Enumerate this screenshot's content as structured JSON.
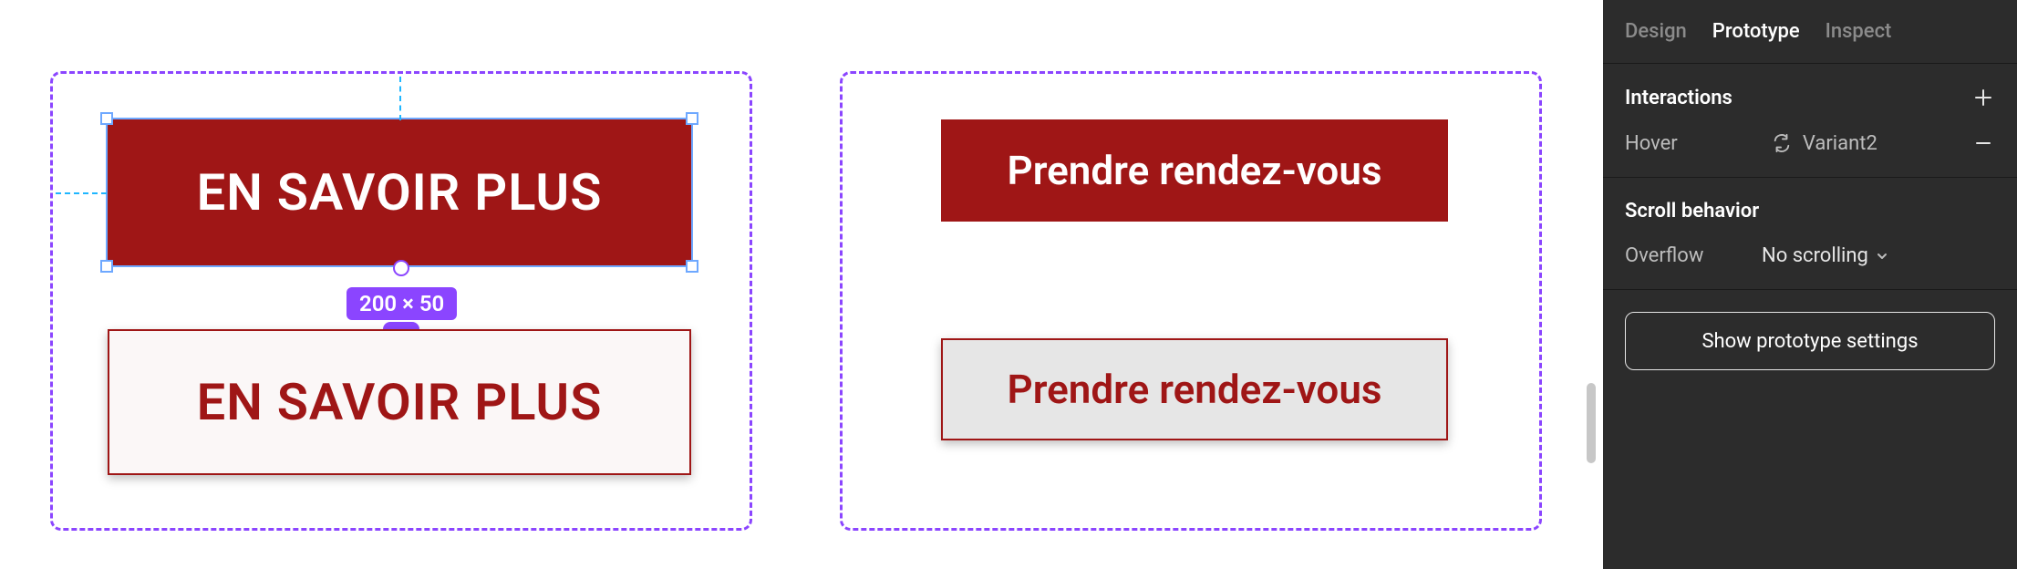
{
  "canvas": {
    "frameA": {
      "btn1": "EN SAVOIR PLUS",
      "btn2": "EN SAVOIR PLUS",
      "dimensions": "200 × 50"
    },
    "frameB": {
      "btn1": "Prendre rendez-vous",
      "btn2": "Prendre rendez-vous"
    }
  },
  "sidebar": {
    "tabs": {
      "design": "Design",
      "prototype": "Prototype",
      "inspect": "Inspect"
    },
    "interactions": {
      "title": "Interactions",
      "item": {
        "trigger": "Hover",
        "action": "Variant2"
      }
    },
    "scroll": {
      "title": "Scroll behavior",
      "overflow_label": "Overflow",
      "overflow_value": "No scrolling"
    },
    "show_settings": "Show prototype settings"
  }
}
